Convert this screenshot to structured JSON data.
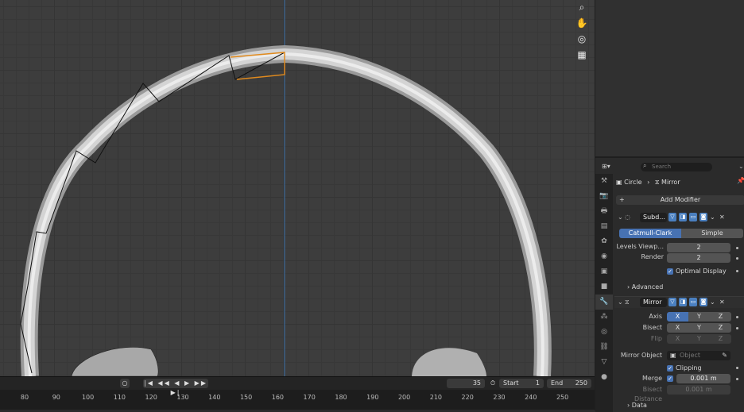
{
  "viewport": {
    "nav_icons": [
      "zoom-icon",
      "hand-icon",
      "camera-icon",
      "grid-icon"
    ]
  },
  "timeline": {
    "current_frame": "35",
    "start_label": "Start",
    "start_value": "1",
    "end_label": "End",
    "end_value": "250",
    "ticks": [
      "80",
      "90",
      "100",
      "110",
      "120",
      "130",
      "140",
      "150",
      "160",
      "170",
      "180",
      "190",
      "200",
      "210",
      "220",
      "230",
      "240",
      "250"
    ]
  },
  "properties": {
    "search_placeholder": "Search",
    "breadcrumb_object": "Circle",
    "breadcrumb_modifier": "Mirror",
    "add_modifier": "Add Modifier",
    "subdiv": {
      "name": "Subd...",
      "mode_catmull": "Catmull-Clark",
      "mode_simple": "Simple",
      "levels_label": "Levels Viewp...",
      "levels_value": "2",
      "render_label": "Render",
      "render_value": "2",
      "optimal_label": "Optimal Display",
      "advanced_label": "Advanced"
    },
    "mirror": {
      "name": "Mirror",
      "axis_label": "Axis",
      "bisect_label": "Bisect",
      "flip_label": "Flip",
      "x": "X",
      "y": "Y",
      "z": "Z",
      "mirror_object_label": "Mirror Object",
      "object_placeholder": "Object",
      "clipping_label": "Clipping",
      "merge_label": "Merge",
      "merge_value": "0.001 m",
      "bisect_distance_label": "Bisect Distance",
      "bisect_distance_value": "0.001 m",
      "data_label": "Data"
    }
  },
  "colors": {
    "accent": "#4772b3",
    "selection": "#e08a1e",
    "axis_line": "#3b6ea5"
  }
}
